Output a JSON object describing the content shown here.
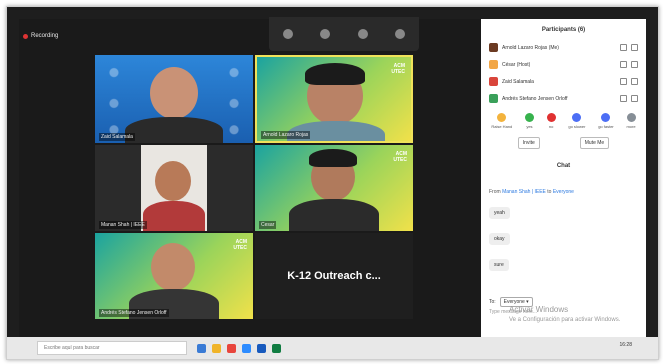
{
  "recording": "Recording",
  "tiles": [
    {
      "name": "Zaid Salamala"
    },
    {
      "name": "Arnold Lazaro Rojas"
    },
    {
      "name": "Manan Shah | IEEE"
    },
    {
      "name": "Cesar"
    },
    {
      "name": "Andrés Stefano Jensen Orloff"
    },
    {
      "name": "K-12 Outreach c..."
    }
  ],
  "panel": {
    "participants_title": "Participants (6)",
    "participants": [
      {
        "name": "Arnold Lazaro Rojas (Me)",
        "color": "#6b3a22"
      },
      {
        "name": "César (Host)",
        "color": "#f2a646"
      },
      {
        "name": "Zaid Salamala",
        "color": "#d9453b"
      },
      {
        "name": "Andrés Stefano Jensen Orloff",
        "color": "#3aa05a"
      }
    ],
    "reactions": [
      "Raise Hand",
      "yes",
      "no",
      "go slower",
      "go faster",
      "more"
    ],
    "invite": "Invite",
    "mute_me": "Mute Me",
    "chat_title": "Chat",
    "from": "From ",
    "from_sender": "Manan Shah | IEEE",
    "to": " to ",
    "to_target": "Everyone",
    "messages": [
      "yeah",
      "okay",
      "sure"
    ],
    "to_label": "To:",
    "to_select": "Everyone ▾",
    "input_placeholder": "Type message here..."
  },
  "watermark": {
    "line1": "Activar Windows",
    "line2": "Ve a Configuración para activar Windows."
  },
  "taskbar": {
    "search": "Escribe aquí para buscar",
    "time": "16:28"
  }
}
